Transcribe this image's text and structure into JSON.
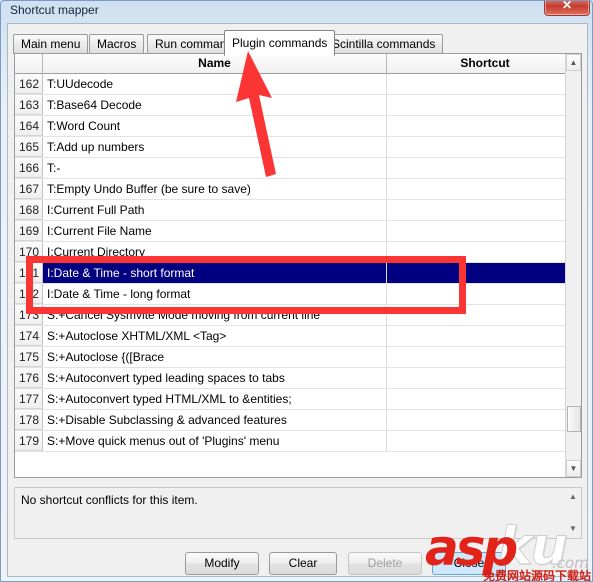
{
  "window": {
    "title": "Shortcut mapper",
    "close_label": "✕"
  },
  "tabs": [
    {
      "label": "Main menu",
      "active": false
    },
    {
      "label": "Macros",
      "active": false
    },
    {
      "label": "Run commands",
      "active": false
    },
    {
      "label": "Plugin commands",
      "active": true
    },
    {
      "label": "Scintilla commands",
      "active": false
    }
  ],
  "list": {
    "columns": {
      "index": "",
      "name": "Name",
      "shortcut": "Shortcut"
    },
    "rows": [
      {
        "index": "162",
        "name": "T:UUdecode",
        "shortcut": "",
        "selected": false
      },
      {
        "index": "163",
        "name": "T:Base64 Decode",
        "shortcut": "",
        "selected": false
      },
      {
        "index": "164",
        "name": "T:Word Count",
        "shortcut": "",
        "selected": false
      },
      {
        "index": "165",
        "name": "T:Add up numbers",
        "shortcut": "",
        "selected": false
      },
      {
        "index": "166",
        "name": "T:-",
        "shortcut": "",
        "selected": false
      },
      {
        "index": "167",
        "name": "T:Empty Undo Buffer (be sure to save)",
        "shortcut": "",
        "selected": false
      },
      {
        "index": "168",
        "name": "I:Current Full Path",
        "shortcut": "",
        "selected": false
      },
      {
        "index": "169",
        "name": "I:Current File Name",
        "shortcut": "",
        "selected": false
      },
      {
        "index": "170",
        "name": "I:Current Directory",
        "shortcut": "",
        "selected": false
      },
      {
        "index": "171",
        "name": "I:Date & Time - short format",
        "shortcut": "",
        "selected": true
      },
      {
        "index": "172",
        "name": "I:Date & Time - long format",
        "shortcut": "",
        "selected": false
      },
      {
        "index": "173",
        "name": "S:+Cancel Sysmvite Mode moving from current line",
        "shortcut": "",
        "selected": false
      },
      {
        "index": "174",
        "name": "S:+Autoclose XHTML/XML <Tag>",
        "shortcut": "",
        "selected": false
      },
      {
        "index": "175",
        "name": "S:+Autoclose {([Brace",
        "shortcut": "",
        "selected": false
      },
      {
        "index": "176",
        "name": "S:+Autoconvert typed leading spaces to tabs",
        "shortcut": "",
        "selected": false
      },
      {
        "index": "177",
        "name": "S:+Autoconvert typed HTML/XML to &entities;",
        "shortcut": "",
        "selected": false
      },
      {
        "index": "178",
        "name": "S:+Disable Subclassing & advanced features",
        "shortcut": "",
        "selected": false
      },
      {
        "index": "179",
        "name": "S:+Move quick menus out of 'Plugins' menu",
        "shortcut": "",
        "selected": false
      }
    ],
    "scrollbar": {
      "up_glyph": "▲",
      "down_glyph": "▼"
    }
  },
  "info": {
    "message": "No shortcut conflicts for this item.",
    "scroll_up_glyph": "▲",
    "scroll_down_glyph": "▼"
  },
  "buttons": {
    "modify": "Modify",
    "clear": "Clear",
    "delete": "Delete",
    "close": "Close"
  },
  "annotations": {
    "highlight_color": "#fb3434",
    "arrow_color": "#fb3434"
  },
  "watermark": {
    "asp": "asp",
    "ku": "ku",
    "com": ".com",
    "tagline": "免费网站源码下载站!"
  }
}
